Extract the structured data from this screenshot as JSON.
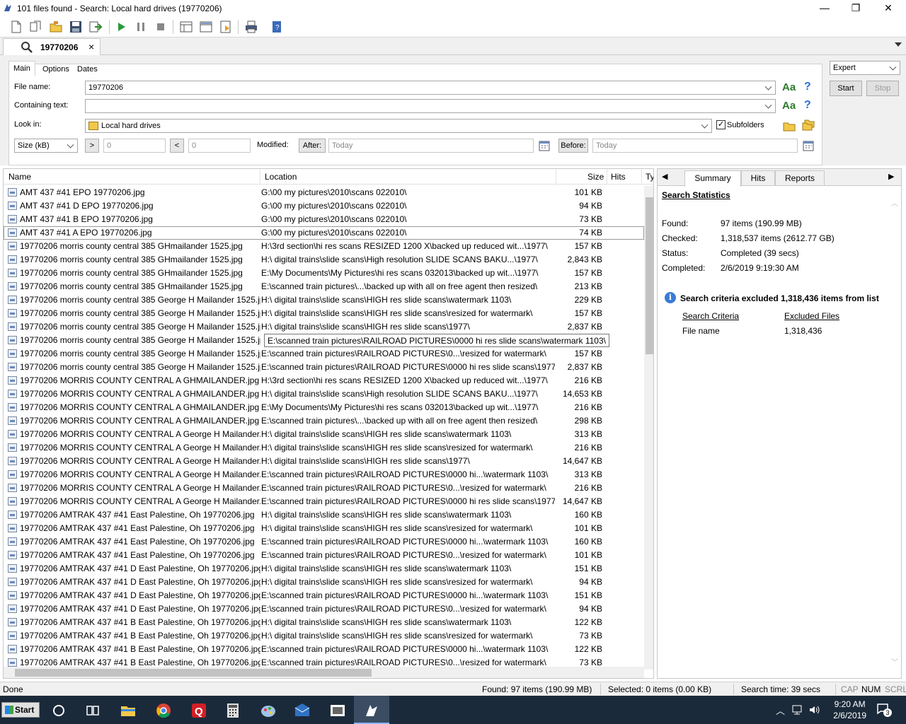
{
  "window": {
    "title": "101 files found - Search: Local hard drives (19770206)",
    "minimize": "—",
    "maximize": "❐",
    "close": "✕"
  },
  "tab": {
    "label": "19770206",
    "close": "×"
  },
  "criteria": {
    "tabs": [
      "Main",
      "Options",
      "Dates"
    ],
    "file_name_label": "File name:",
    "file_name_value": "19770206",
    "containing_text_label": "Containing text:",
    "containing_text_value": "",
    "look_in_label": "Look in:",
    "look_in_value": "Local hard drives",
    "subfolders_label": "Subfolders",
    "subfolders_checked": true,
    "size_unit": "Size (kB)",
    "gt_btn": ">",
    "gt_value": "0",
    "lt_btn": "<",
    "lt_value": "0",
    "modified_label": "Modified:",
    "after_btn": "After:",
    "after_value": "Today",
    "before_btn": "Before:",
    "before_value": "Today",
    "aa_label": "Aa",
    "help_label": "?",
    "mode": "Expert",
    "start_label": "Start",
    "stop_label": "Stop"
  },
  "results": {
    "columns": [
      "Name",
      "Location",
      "Size",
      "Hits",
      "Ty"
    ],
    "tooltip": "E:\\scanned train pictures\\RAILROAD PICTURES\\0000 hi res slide scans\\watermark 1103\\",
    "rows": [
      {
        "name": "AMT 437 #41 EPO 19770206.jpg",
        "location": "G:\\00 my pictures\\2010\\scans 022010\\",
        "size": "101 KB"
      },
      {
        "name": "AMT 437 #41 D EPO 19770206.jpg",
        "location": "G:\\00 my pictures\\2010\\scans 022010\\",
        "size": "94 KB"
      },
      {
        "name": "AMT 437 #41 B EPO 19770206.jpg",
        "location": "G:\\00 my pictures\\2010\\scans 022010\\",
        "size": "73 KB"
      },
      {
        "name": "AMT 437 #41 A EPO 19770206.jpg",
        "location": "G:\\00 my pictures\\2010\\scans 022010\\",
        "size": "74 KB"
      },
      {
        "name": "19770206 morris county central 385 GHmailander 1525.jpg",
        "location": "H:\\3rd section\\hi res scans RESIZED 1200 X\\backed up reduced wit...\\1977\\",
        "size": "157 KB"
      },
      {
        "name": "19770206 morris county central 385 GHmailander 1525.jpg",
        "location": "H:\\ digital trains\\slide scans\\High resolution SLIDE SCANS  BAKU...\\1977\\",
        "size": "2,843 KB"
      },
      {
        "name": "19770206 morris county central 385 GHmailander 1525.jpg",
        "location": "E:\\My Documents\\My Pictures\\hi res scans 032013\\backed up wit...\\1977\\",
        "size": "157 KB"
      },
      {
        "name": "19770206 morris county central 385 GHmailander 1525.jpg",
        "location": "E:\\scanned train pictures\\...\\backed up with all on free agent then resized\\",
        "size": "213 KB"
      },
      {
        "name": "19770206 morris county central 385 George H Mailander 1525.jpg",
        "location": "H:\\ digital trains\\slide scans\\HIGH res slide scans\\watermark 1103\\",
        "size": "229 KB"
      },
      {
        "name": "19770206 morris county central 385 George H Mailander 1525.jpg",
        "location": "H:\\ digital trains\\slide scans\\HIGH res slide scans\\resized for watermark\\",
        "size": "157 KB"
      },
      {
        "name": "19770206 morris county central 385 George H Mailander 1525.jpg",
        "location": "H:\\ digital trains\\slide scans\\HIGH res slide scans\\1977\\",
        "size": "2,837 KB"
      },
      {
        "name": "19770206 morris county central 385 George H Mailander 1525.jpg",
        "location": "",
        "size": ""
      },
      {
        "name": "19770206 morris county central 385 George H Mailander 1525.jpg",
        "location": "E:\\scanned train pictures\\RAILROAD PICTURES\\0...\\resized for watermark\\",
        "size": "157 KB"
      },
      {
        "name": "19770206 morris county central 385 George H Mailander 1525.jpg",
        "location": "E:\\scanned train pictures\\RAILROAD PICTURES\\0000 hi res slide scans\\1977\\",
        "size": "2,837 KB"
      },
      {
        "name": "19770206 MORRIS COUNTY CENTRAL  A GHMAILANDER.jpg",
        "location": "H:\\3rd section\\hi res scans RESIZED 1200 X\\backed up reduced wit...\\1977\\",
        "size": "216 KB"
      },
      {
        "name": "19770206 MORRIS COUNTY CENTRAL  A GHMAILANDER.jpg",
        "location": "H:\\ digital trains\\slide scans\\High resolution SLIDE SCANS  BAKU...\\1977\\",
        "size": "14,653 KB"
      },
      {
        "name": "19770206 MORRIS COUNTY CENTRAL  A GHMAILANDER.jpg",
        "location": "E:\\My Documents\\My Pictures\\hi res scans 032013\\backed up wit...\\1977\\",
        "size": "216 KB"
      },
      {
        "name": "19770206 MORRIS COUNTY CENTRAL  A GHMAILANDER.jpg",
        "location": "E:\\scanned train pictures\\...\\backed up with all on free agent then resized\\",
        "size": "298 KB"
      },
      {
        "name": "19770206 MORRIS COUNTY CENTRAL  A George H Mailander.jpg",
        "location": "H:\\ digital trains\\slide scans\\HIGH res slide scans\\watermark 1103\\",
        "size": "313 KB"
      },
      {
        "name": "19770206 MORRIS COUNTY CENTRAL  A George H Mailander.jpg",
        "location": "H:\\ digital trains\\slide scans\\HIGH res slide scans\\resized for watermark\\",
        "size": "216 KB"
      },
      {
        "name": "19770206 MORRIS COUNTY CENTRAL  A George H Mailander.jpg",
        "location": "H:\\ digital trains\\slide scans\\HIGH res slide scans\\1977\\",
        "size": "14,647 KB"
      },
      {
        "name": "19770206 MORRIS COUNTY CENTRAL  A George H Mailander.jpg",
        "location": "E:\\scanned train pictures\\RAILROAD PICTURES\\0000 hi...\\watermark 1103\\",
        "size": "313 KB"
      },
      {
        "name": "19770206 MORRIS COUNTY CENTRAL  A George H Mailander.jpg",
        "location": "E:\\scanned train pictures\\RAILROAD PICTURES\\0...\\resized for watermark\\",
        "size": "216 KB"
      },
      {
        "name": "19770206 MORRIS COUNTY CENTRAL  A George H Mailander.jpg",
        "location": "E:\\scanned train pictures\\RAILROAD PICTURES\\0000 hi res slide scans\\1977\\",
        "size": "14,647 KB"
      },
      {
        "name": "19770206 AMTRAK 437 #41 East Palestine, Oh 19770206.jpg",
        "location": "H:\\ digital trains\\slide scans\\HIGH res slide scans\\watermark 1103\\",
        "size": "160 KB"
      },
      {
        "name": "19770206 AMTRAK 437 #41 East Palestine, Oh 19770206.jpg",
        "location": "H:\\ digital trains\\slide scans\\HIGH res slide scans\\resized for watermark\\",
        "size": "101 KB"
      },
      {
        "name": "19770206 AMTRAK 437 #41 East Palestine, Oh 19770206.jpg",
        "location": "E:\\scanned train pictures\\RAILROAD PICTURES\\0000 hi...\\watermark 1103\\",
        "size": "160 KB"
      },
      {
        "name": "19770206 AMTRAK 437 #41 East Palestine, Oh 19770206.jpg",
        "location": "E:\\scanned train pictures\\RAILROAD PICTURES\\0...\\resized for watermark\\",
        "size": "101 KB"
      },
      {
        "name": "19770206 AMTRAK 437 #41 D East Palestine, Oh 19770206.jpg",
        "location": "H:\\ digital trains\\slide scans\\HIGH res slide scans\\watermark 1103\\",
        "size": "151 KB"
      },
      {
        "name": "19770206 AMTRAK 437 #41 D East Palestine, Oh 19770206.jpg",
        "location": "H:\\ digital trains\\slide scans\\HIGH res slide scans\\resized for watermark\\",
        "size": "94 KB"
      },
      {
        "name": "19770206 AMTRAK 437 #41 D East Palestine, Oh 19770206.jpg",
        "location": "E:\\scanned train pictures\\RAILROAD PICTURES\\0000 hi...\\watermark 1103\\",
        "size": "151 KB"
      },
      {
        "name": "19770206 AMTRAK 437 #41 D East Palestine, Oh 19770206.jpg",
        "location": "E:\\scanned train pictures\\RAILROAD PICTURES\\0...\\resized for watermark\\",
        "size": "94 KB"
      },
      {
        "name": "19770206 AMTRAK 437 #41 B East Palestine, Oh 19770206.jpg",
        "location": "H:\\ digital trains\\slide scans\\HIGH res slide scans\\watermark 1103\\",
        "size": "122 KB"
      },
      {
        "name": "19770206 AMTRAK 437 #41 B East Palestine, Oh 19770206.jpg",
        "location": "H:\\ digital trains\\slide scans\\HIGH res slide scans\\resized for watermark\\",
        "size": "73 KB"
      },
      {
        "name": "19770206 AMTRAK 437 #41 B East Palestine, Oh 19770206.jpg",
        "location": "E:\\scanned train pictures\\RAILROAD PICTURES\\0000 hi...\\watermark 1103\\",
        "size": "122 KB"
      },
      {
        "name": "19770206 AMTRAK 437 #41 B East Palestine, Oh 19770206.jpg",
        "location": "E:\\scanned train pictures\\RAILROAD PICTURES\\0...\\resized for watermark\\",
        "size": "73 KB"
      }
    ]
  },
  "summary": {
    "tabs": [
      "Summary",
      "Hits",
      "Reports"
    ],
    "title": "Search Statistics",
    "found_label": "Found:",
    "found_value": "97 items (190.99 MB)",
    "checked_label": "Checked:",
    "checked_value": "1,318,537 items (2612.77 GB)",
    "status_label": "Status:",
    "status_value": "Completed (39 secs)",
    "completed_label": "Completed:",
    "completed_value": "2/6/2019 9:19:30 AM",
    "excluded_msg": "Search criteria excluded 1,318,436 items from list",
    "criteria_header": "Search Criteria",
    "excluded_header": "Excluded Files",
    "criteria_row_label": "File name",
    "criteria_row_value": "1,318,436"
  },
  "statusbar": {
    "left": "Done",
    "found": "Found: 97 items (190.99 MB)",
    "selected": "Selected: 0 items (0.00 KB)",
    "search_time": "Search time: 39 secs",
    "cap": "CAP",
    "num": "NUM",
    "scrl": "SCRL"
  },
  "taskbar": {
    "start_label": "Start",
    "time": "9:20 AM",
    "date": "2/6/2019",
    "notif_count": "3"
  },
  "colors": {
    "accent_blue": "#2a6fd6",
    "aa_green": "#2c7a2c",
    "taskbar": "#1b2a3a"
  }
}
